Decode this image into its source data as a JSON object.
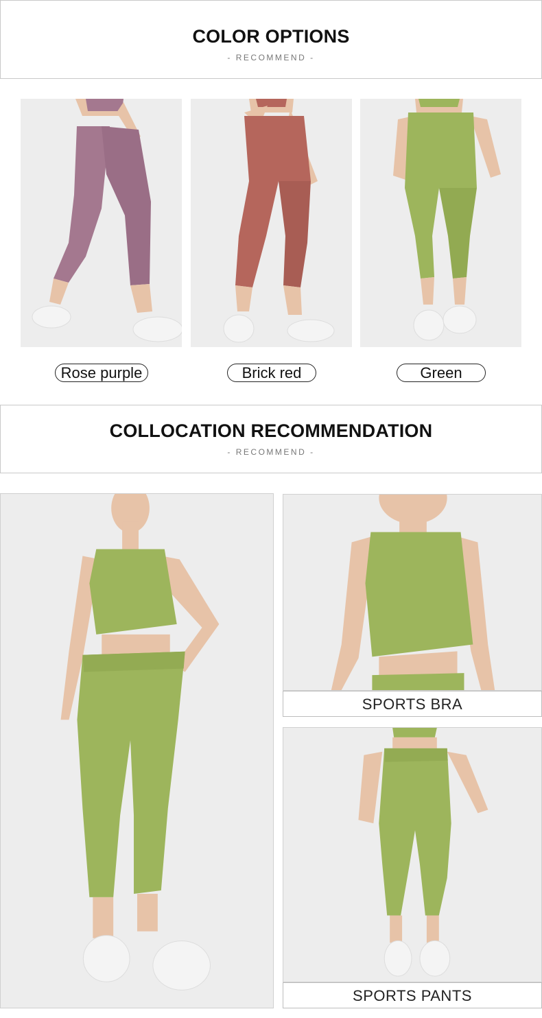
{
  "color_options": {
    "title": "COLOR OPTIONS",
    "subtitle": "-   RECOMMEND   -",
    "items": [
      {
        "label": "Rose purple",
        "color": "#a4788f"
      },
      {
        "label": "Brick red",
        "color": "#b5665c"
      },
      {
        "label": "Green",
        "color": "#9db55c"
      }
    ]
  },
  "collocation": {
    "title": "COLLOCATION RECOMMENDATION",
    "subtitle": "-   RECOMMEND   -",
    "set_color": "#9db55c",
    "bra_caption": "SPORTS BRA",
    "pants_caption": "SPORTS PANTS"
  },
  "palette": {
    "skin": "#e7c3a8",
    "shoe": "#f4f4f4",
    "photo_bg": "#ededed"
  }
}
